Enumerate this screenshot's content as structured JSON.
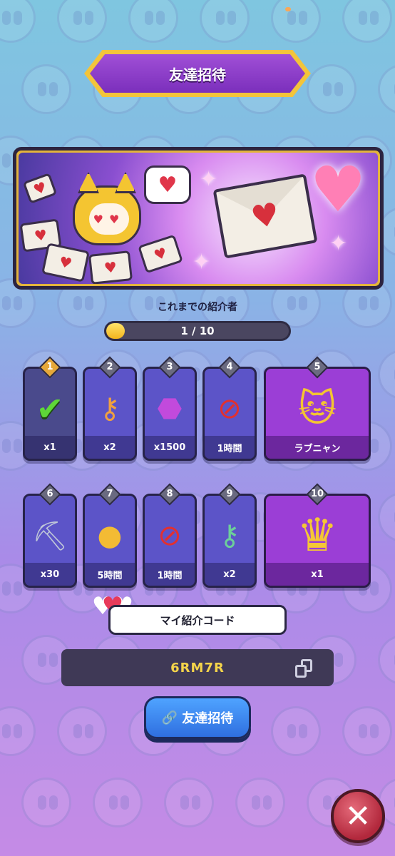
{
  "header": {
    "title": "友達招待"
  },
  "progress": {
    "label": "これまでの紹介者",
    "text": "1 / 10",
    "current": 1,
    "total": 10
  },
  "rewards_row1": [
    {
      "n": "1",
      "label": "x1",
      "icon": "check-icon",
      "done": true
    },
    {
      "n": "2",
      "label": "x2",
      "icon": "key-icon"
    },
    {
      "n": "3",
      "label": "x1500",
      "icon": "gem-icon"
    },
    {
      "n": "4",
      "label": "1時間",
      "icon": "no-ads-icon"
    },
    {
      "n": "5",
      "label": "ラブニャン",
      "icon": "cat-character-icon"
    }
  ],
  "rewards_row2": [
    {
      "n": "6",
      "label": "x30",
      "icon": "pickaxe-icon"
    },
    {
      "n": "7",
      "label": "5時間",
      "icon": "coin-stack-icon"
    },
    {
      "n": "8",
      "label": "1時間",
      "icon": "no-ads-icon"
    },
    {
      "n": "9",
      "label": "x2",
      "icon": "green-key-icon"
    },
    {
      "n": "10",
      "label": "x1",
      "icon": "royal-chest-icon"
    }
  ],
  "referral": {
    "title": "マイ紹介コード",
    "code": "6RM7R"
  },
  "invite_button": {
    "label": "友達招待"
  },
  "colors": {
    "accent_purple": "#7b2fbc",
    "button_blue": "#2f6fe0",
    "close_red": "#b2283c",
    "gold": "#f3c43a"
  }
}
